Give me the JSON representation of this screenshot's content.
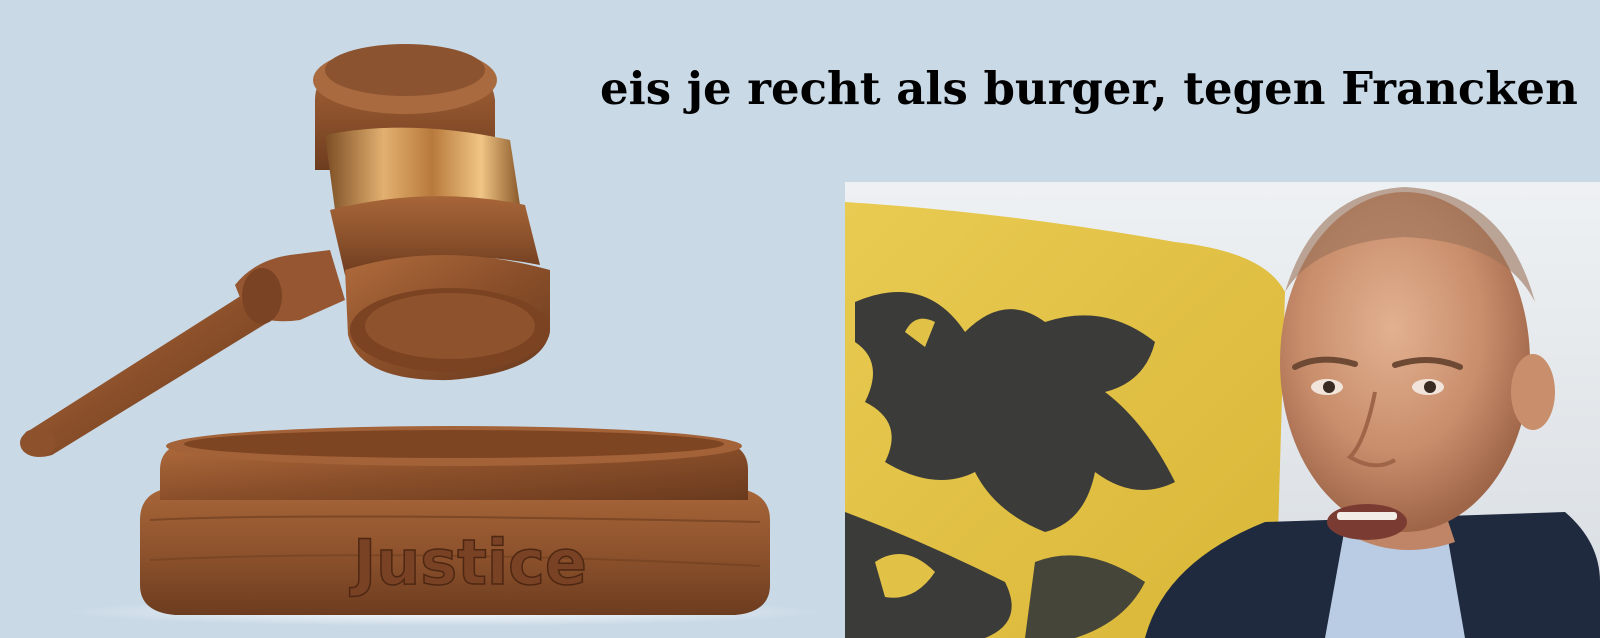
{
  "headline": "eis je recht als burger, tegen Francken",
  "gavel_base_engraving": "Justice",
  "icons": {
    "gavel": "gavel-icon",
    "sound_block": "sound-block-icon",
    "flag": "flemish-lion-flag",
    "person": "person-portrait"
  },
  "colors": {
    "background": "#c9d9e6",
    "wood": "#8a4f2a",
    "brass": "#c9925a",
    "flag_yellow": "#e7c743",
    "flag_black": "#2a2f36",
    "suit": "#1f2a3f"
  }
}
